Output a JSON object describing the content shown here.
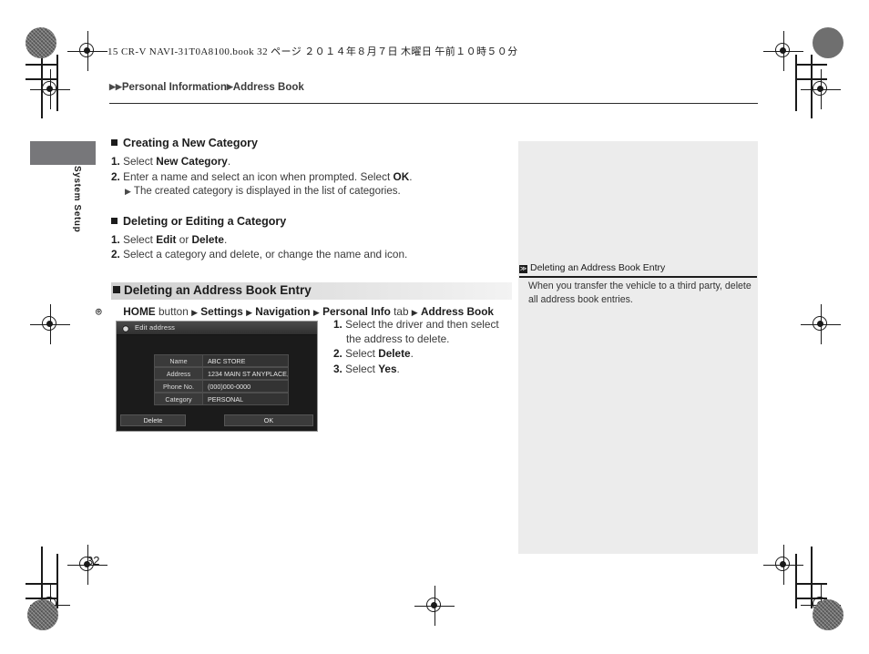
{
  "print_header": {
    "book_line": "15 CR-V NAVI-31T0A8100.book  32 ページ  ２０１４年８月７日  木曜日  午前１０時５０分"
  },
  "breadcrumb": {
    "arrow": "▶",
    "parent": "Personal Information",
    "current": "Address Book"
  },
  "side_tab": {
    "label": "System Setup"
  },
  "main": {
    "section1": {
      "heading": "Creating a New Category",
      "steps": [
        {
          "num": "1.",
          "pre": "Select ",
          "bold": "New Category",
          "post": "."
        },
        {
          "num": "2.",
          "pre": "Enter a name and select an icon when prompted. Select ",
          "bold": "OK",
          "post": "."
        }
      ],
      "substep": "The created category is displayed in the list of categories."
    },
    "section2": {
      "heading": "Deleting or Editing a Category",
      "steps": [
        {
          "num": "1.",
          "pre": "Select ",
          "bold": "Edit",
          "mid": " or ",
          "bold2": "Delete",
          "post": "."
        },
        {
          "num": "2.",
          "pre": "Select a category and delete, or change the name and icon.",
          "bold": "",
          "post": ""
        }
      ]
    },
    "section3": {
      "heading": "Deleting an Address Book Entry",
      "nav_path": {
        "home_icon": "⌾",
        "home": "HOME",
        "button_word": "button",
        "arrow": "▶",
        "items": [
          "Settings",
          "Navigation",
          "Personal Info",
          "Address Book"
        ],
        "tab_word": "tab"
      },
      "steps": [
        {
          "num": "1.",
          "text": "Select the driver and then select the address to delete."
        },
        {
          "num": "2.",
          "pre": "Select ",
          "bold": "Delete",
          "post": "."
        },
        {
          "num": "3.",
          "pre": "Select ",
          "bold": "Yes",
          "post": "."
        }
      ]
    }
  },
  "screenshot": {
    "title": "Edit address",
    "gear_icon": "gear-icon",
    "rows": [
      {
        "label": "Name",
        "value": "ABC STORE"
      },
      {
        "label": "Address",
        "value": "1234 MAIN ST ANYPLACE,"
      },
      {
        "label": "Phone No.",
        "value": "(000)000-0000"
      },
      {
        "label": "Category",
        "value": "PERSONAL"
      }
    ],
    "buttons": {
      "left": "Delete",
      "right": "OK"
    }
  },
  "note": {
    "badge": "≫",
    "title": "Deleting an Address Book Entry",
    "body": "When you transfer the vehicle to a third party, delete all address book entries."
  },
  "page_number": "32",
  "colors": {
    "tab_gray": "#77777a",
    "note_panel": "#ececec",
    "heading_bar": "#d0d0d0",
    "text": "#231f20"
  }
}
